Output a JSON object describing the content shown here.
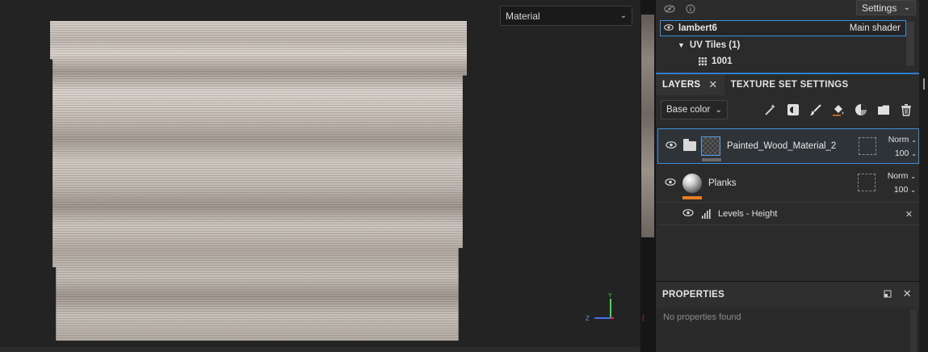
{
  "viewport": {
    "display_select": "Material",
    "gizmo": {
      "axis_y": "Y",
      "axis_z": "Z"
    },
    "material_preview": "painted-wood-texture"
  },
  "panel": {
    "topbar": {
      "settings_label": "Settings",
      "icons": [
        "eye-hidden-icon",
        "info-icon"
      ]
    },
    "texture_sets": {
      "material_name": "lambert6",
      "material_shader": "Main shader",
      "uv_tiles_label": "UV Tiles (1)",
      "tile_name": "1001"
    },
    "tabs": [
      {
        "label": "LAYERS",
        "active": true
      },
      {
        "label": "TEXTURE SET SETTINGS",
        "active": false
      }
    ],
    "toolbar": {
      "channel": "Base color",
      "tools": [
        "magic-wand-icon",
        "add-mask-icon",
        "paint-brush-icon",
        "fill-bucket-icon",
        "add-effect-icon",
        "folder-icon",
        "trash-icon"
      ]
    },
    "layers": [
      {
        "name": "Painted_Wood_Material_2",
        "blend": "Norm",
        "opacity": "100",
        "type": "folder",
        "bar_color": "#6a6a6a"
      },
      {
        "name": "Planks",
        "blend": "Norm",
        "opacity": "100",
        "type": "fill",
        "bar_color": "#e67e22"
      }
    ],
    "effect": {
      "name": "Levels - Height"
    },
    "properties": {
      "title": "PROPERTIES",
      "empty_text": "No properties found"
    }
  },
  "colors": {
    "accent": "#2f7fd1",
    "selection": "#3b8fd8",
    "orange_bar": "#e67e22"
  }
}
